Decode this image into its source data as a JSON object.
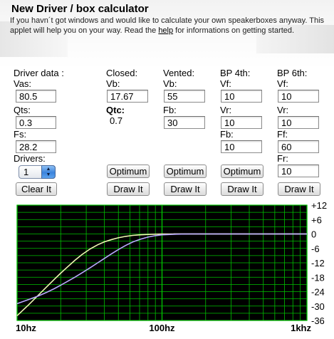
{
  "page": {
    "title": "New Driver / box calculator",
    "intro_part1": "If you havn´t got windows and would like to calculate your own speakerboxes anyway. This applet will help you on your way. Read the ",
    "intro_link": "help",
    "intro_part2": " for informations on getting started."
  },
  "driver": {
    "header": "Driver data :",
    "vas_label": "Vas:",
    "vas_value": "80.5",
    "qts_label": "Qts:",
    "qts_value": "0.3",
    "fs_label": "Fs:",
    "fs_value": "28.2",
    "drivers_label": "Drivers:",
    "drivers_value": "1",
    "clear_button": "Clear It"
  },
  "closed": {
    "header": "Closed:",
    "vb_label": "Vb:",
    "vb_value": "17.67",
    "qtc_label": "Qtc:",
    "qtc_value": "0.7",
    "optimum_button": "Optimum",
    "draw_button": "Draw It"
  },
  "vented": {
    "header": "Vented:",
    "vb_label": "Vb:",
    "vb_value": "55",
    "fb_label": "Fb:",
    "fb_value": "30",
    "optimum_button": "Optimum",
    "draw_button": "Draw It"
  },
  "bp4": {
    "header": "BP 4th:",
    "vf_label": "Vf:",
    "vf_value": "10",
    "vr_label": "Vr:",
    "vr_value": "10",
    "fb_label": "Fb:",
    "fb_value": "10",
    "optimum_button": "Optimum",
    "draw_button": "Draw It"
  },
  "bp6": {
    "header": "BP 6th:",
    "vf_label": "Vf:",
    "vf_value": "10",
    "vr_label": "Vr:",
    "vr_value": "10",
    "ff_label": "Ff:",
    "ff_value": "60",
    "fr_label": "Fr:",
    "fr_value": "10",
    "draw_button": "Draw It"
  },
  "colors": {
    "plot_background": "#000000",
    "grid": "#00c000",
    "closed_curve": "#eef7b0",
    "vented_curve": "#b9a8ff",
    "zero_line": "#ffffff"
  },
  "chart_data": {
    "type": "line",
    "x_scale": "log",
    "xlim": [
      10,
      1000
    ],
    "ylim": [
      -36,
      12
    ],
    "x_tick_labels": [
      "10hz",
      "100hz",
      "1khz"
    ],
    "y_tick_labels": [
      "+12",
      "+6",
      "0",
      "-6",
      "-12",
      "-18",
      "-24",
      "-30",
      "-36"
    ],
    "y_ticks": [
      12,
      6,
      0,
      -6,
      -12,
      -18,
      -24,
      -30,
      -36
    ],
    "grid": true,
    "series": [
      {
        "color": "#eef7b0",
        "x": [
          10,
          12,
          14,
          16,
          18,
          20,
          22,
          25,
          28,
          32,
          36,
          40,
          45,
          50,
          56,
          63,
          71,
          80,
          90,
          100,
          126,
          158,
          200,
          1000
        ],
        "y": [
          -34,
          -29.5,
          -25.5,
          -22,
          -19,
          -16.3,
          -14,
          -11,
          -8.6,
          -6.2,
          -4.5,
          -3.3,
          -2.3,
          -1.6,
          -1.0,
          -0.6,
          -0.35,
          -0.2,
          -0.1,
          0,
          0,
          0,
          0,
          0
        ]
      },
      {
        "color": "#b9a8ff",
        "x": [
          10,
          12,
          14,
          16,
          18,
          20,
          22,
          25,
          28,
          32,
          36,
          40,
          45,
          50,
          56,
          63,
          71,
          80,
          90,
          100,
          126,
          158,
          200,
          1000
        ],
        "y": [
          -29,
          -27.3,
          -25.8,
          -24.3,
          -22.8,
          -21.3,
          -19.9,
          -18,
          -16.2,
          -14,
          -12,
          -10.2,
          -8.2,
          -6.5,
          -4.8,
          -3.3,
          -2.2,
          -1.3,
          -0.7,
          -0.35,
          -0.1,
          0,
          0,
          0
        ]
      }
    ]
  }
}
